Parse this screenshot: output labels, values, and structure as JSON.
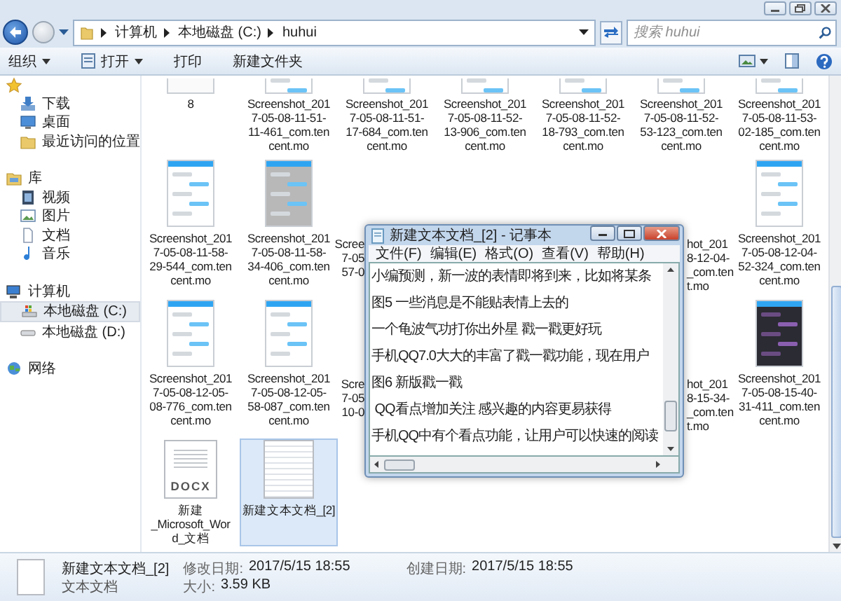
{
  "address_bar": {
    "breadcrumbs": [
      "计算机",
      "本地磁盘 (C:)",
      "huhui"
    ]
  },
  "search": {
    "placeholder": "搜索 huhui"
  },
  "toolbar": {
    "items": [
      {
        "label": "组织",
        "icon": false,
        "dropdown": true
      },
      {
        "label": "打开",
        "icon": true,
        "dropdown": true
      },
      {
        "label": "打印",
        "icon": false,
        "dropdown": false
      },
      {
        "label": "新建文件夹",
        "icon": false,
        "dropdown": false
      }
    ]
  },
  "sidebar": {
    "items": [
      {
        "kind": "star",
        "selected": false,
        "children": [
          {
            "label": "下载",
            "kind": "download",
            "selected": false
          },
          {
            "label": "桌面",
            "kind": "desktop",
            "selected": false
          },
          {
            "label": "最近访问的位置",
            "kind": "recent",
            "selected": false
          }
        ]
      },
      {
        "label": "库",
        "kind": "library",
        "selected": false,
        "children": [
          {
            "label": "视频",
            "kind": "video",
            "selected": false
          },
          {
            "label": "图片",
            "kind": "picture",
            "selected": false
          },
          {
            "label": "文档",
            "kind": "document",
            "selected": false
          },
          {
            "label": "音乐",
            "kind": "music",
            "selected": false
          }
        ]
      },
      {
        "label": "计算机",
        "kind": "computer",
        "selected": false,
        "children": [
          {
            "label": "本地磁盘 (C:)",
            "kind": "drive_c",
            "selected": true
          },
          {
            "label": "本地磁盘 (D:)",
            "kind": "drive",
            "selected": false
          }
        ]
      },
      {
        "label": "网络",
        "kind": "network",
        "selected": false
      }
    ]
  },
  "files": {
    "rows": [
      {
        "kind": "cut_top",
        "items": [
          {
            "kind": "blank",
            "label": [
              "8"
            ],
            "selected": false
          },
          {
            "kind": "light",
            "label": [
              "Screenshot_201",
              "7-05-08-11-51-",
              "11-461_com.ten",
              "cent.mo"
            ],
            "selected": false
          },
          {
            "kind": "light",
            "label": [
              "Screenshot_201",
              "7-05-08-11-51-",
              "17-684_com.ten",
              "cent.mo"
            ],
            "selected": false
          },
          {
            "kind": "light",
            "label": [
              "Screenshot_201",
              "7-05-08-11-52-",
              "13-906_com.ten",
              "cent.mo"
            ],
            "selected": false
          },
          {
            "kind": "light",
            "label": [
              "Screenshot_201",
              "7-05-08-11-52-",
              "18-793_com.ten",
              "cent.mo"
            ],
            "selected": false
          },
          {
            "kind": "light",
            "label": [
              "Screenshot_201",
              "7-05-08-11-52-",
              "53-123_com.ten",
              "cent.mo"
            ],
            "selected": false
          },
          {
            "kind": "light",
            "label": [
              "Screenshot_201",
              "7-05-08-11-53-",
              "02-185_com.ten",
              "cent.mo"
            ],
            "selected": false
          }
        ]
      },
      {
        "kind": "full",
        "items": [
          {
            "kind": "light",
            "label": [
              "Screenshot_201",
              "7-05-08-11-58-",
              "29-544_com.ten",
              "cent.mo"
            ],
            "selected": false
          },
          {
            "kind": "grey",
            "label": [
              "Screenshot_201",
              "7-05-08-11-58-",
              "34-406_com.ten",
              "cent.mo"
            ],
            "selected": false
          },
          {
            "kind": "cut_right",
            "label": [
              "Scree",
              "7-05",
              "57-0"
            ],
            "selected": false
          },
          {
            "kind": "cut_left",
            "label": [
              "hot_201",
              "8-12-04-",
              "_com.ten",
              "t.mo"
            ],
            "selected": false
          },
          {
            "kind": "light",
            "label": [
              "Screenshot_201",
              "7-05-08-12-04-",
              "52-324_com.ten",
              "cent.mo"
            ],
            "selected": false
          }
        ]
      },
      {
        "kind": "full",
        "items": [
          {
            "kind": "light",
            "label": [
              "Screenshot_201",
              "7-05-08-12-05-",
              "08-776_com.ten",
              "cent.mo"
            ],
            "selected": false
          },
          {
            "kind": "light",
            "label": [
              "Screenshot_201",
              "7-05-08-12-05-",
              "58-087_com.ten",
              "cent.mo"
            ],
            "selected": false
          },
          {
            "kind": "cut_right",
            "label": [
              "Scre",
              "7-05",
              "10-0"
            ],
            "selected": false
          },
          {
            "kind": "cut_left",
            "label": [
              "hot_201",
              "8-15-34-",
              "_com.ten",
              "t.mo"
            ],
            "selected": false
          },
          {
            "kind": "dark",
            "label": [
              "Screenshot_201",
              "7-05-08-15-40-",
              "31-411_com.ten",
              "cent.mo"
            ],
            "selected": false
          }
        ]
      },
      {
        "kind": "full",
        "items": [
          {
            "kind": "docx",
            "badge": "DOCX",
            "label": [
              "新建",
              "_Microsoft_Wor",
              "d_文档"
            ],
            "selected": false
          },
          {
            "kind": "text",
            "label": [
              "新建文本文档_[2]"
            ],
            "selected": true
          }
        ]
      }
    ]
  },
  "notepad": {
    "title": "新建文本文档_[2] - 记事本",
    "menu": [
      "文件(F)",
      "编辑(E)",
      "格式(O)",
      "查看(V)",
      "帮助(H)"
    ],
    "lines": [
      "小编预测，新一波的表情即将到来，比如将某条",
      "图5 一些消息是不能贴表情上去的",
      "一个龟波气功打你出外星 戳一戳更好玩",
      "手机QQ7.0大大的丰富了戳一戳功能，现在用户",
      "图6 新版戳一戳",
      " QQ看点增加关注 感兴趣的内容更易获得",
      "手机QQ中有个看点功能，让用户可以快速的阅读"
    ]
  },
  "status_bar": {
    "filename": "新建文本文档_[2]",
    "type": "文本文档",
    "fields": [
      {
        "label": "修改日期:",
        "value": "2017/5/15 18:55"
      },
      {
        "label": "大小:",
        "value": "3.59 KB"
      },
      {
        "label": "创建日期:",
        "value": "2017/5/15 18:55"
      }
    ]
  }
}
